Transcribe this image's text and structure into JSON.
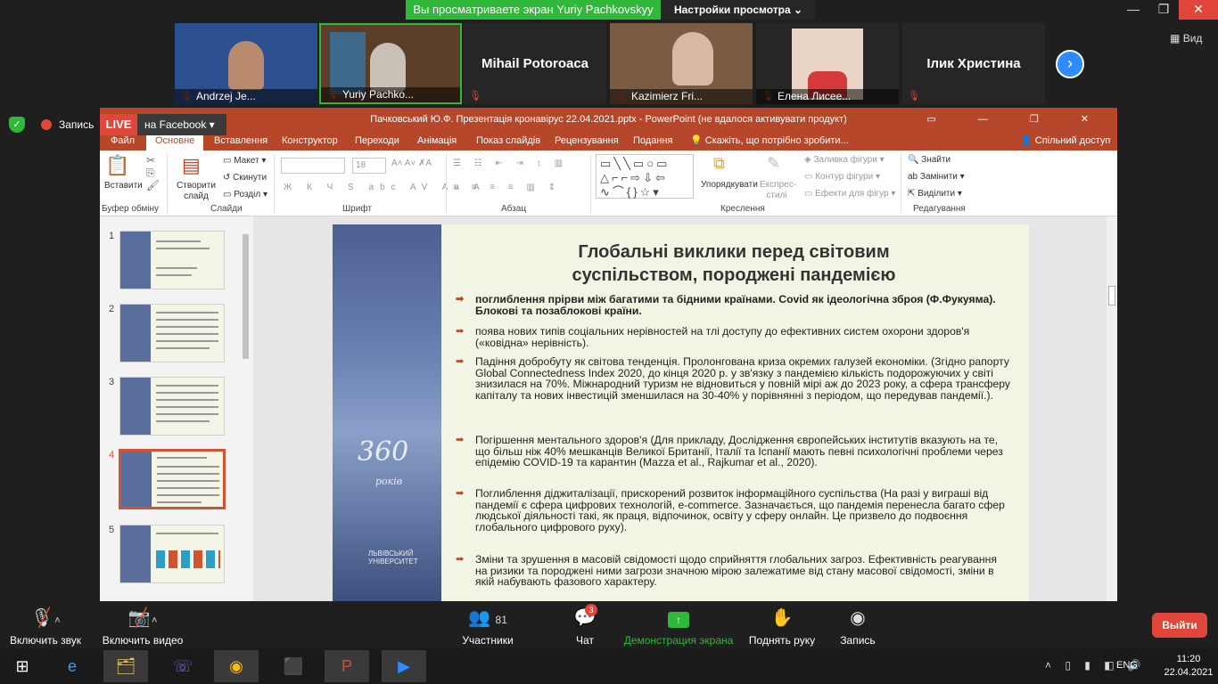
{
  "zoom_top": {
    "share_banner": "Вы просматриваете экран Yuriy Pachkovskyy",
    "view_settings": "Настройки просмотра",
    "view_label": "Вид",
    "win_min": "▭",
    "win_restore": "❐",
    "win_close": "✕"
  },
  "participants": [
    {
      "name": "Andrzej Je...",
      "type": "video"
    },
    {
      "name": "Yuriy Pachko...",
      "type": "video"
    },
    {
      "name": "Mihail Potoroaca",
      "type": "name"
    },
    {
      "name": "Kazimierz Fri...",
      "type": "video"
    },
    {
      "name": "Елена Лисее...",
      "type": "video"
    },
    {
      "name": "Ілик Христина",
      "type": "name"
    }
  ],
  "recording": {
    "label": "Запись",
    "live": "LIVE",
    "live_target": "на Facebook"
  },
  "ppt": {
    "title": "Пачковський Ю.Ф. Презентація кронавірус  22.04.2021.pptx  -  PowerPoint (не вдалося активувати продукт)",
    "tabs": [
      "Файл",
      "Основне",
      "Вставлення",
      "Конструктор",
      "Переходи",
      "Анімація",
      "Показ слайдів",
      "Рецензування",
      "Подання"
    ],
    "search": "Скажіть, що потрібно зробити...",
    "share": "Спільний доступ",
    "ribbon": {
      "paste": "Вставити",
      "new_slide": "Створити слайд",
      "layout": "Макет",
      "reset": "Скинути",
      "section": "Розділ",
      "font_size": "18",
      "arrange": "Упорядкувати",
      "quick_styles": "Експрес-стилі",
      "fill": "Заливка фігури",
      "outline": "Контур фігури",
      "effects": "Ефекти для фігур",
      "find": "Знайти",
      "replace": "Замінити",
      "select": "Виділити",
      "groups": [
        "Буфер обміну",
        "Слайди",
        "Шрифт",
        "Абзац",
        "Креслення",
        "Редагування"
      ]
    },
    "thumbs": [
      "1",
      "2",
      "3",
      "4",
      "5"
    ],
    "slide": {
      "title_line1": "Глобальні виклики перед світовим",
      "title_line2": "суспільством, породжені пандемією",
      "brand_number": "360",
      "brand_word": "років",
      "brand_uni": "ЛЬВІВСЬКИЙ УНІВЕРСИТЕТ",
      "bullets": [
        "поглиблення прірви між багатими та бідними країнами. Covid як ідеологічна зброя  (Ф.Фукуяма). Блокові та позаблокові країни.",
        "поява нових типів соціальних нерівностей на тлі доступу до ефективних систем охорони здоров'я («ковідна» нерівність).",
        "Падіння добробуту як світова тенденція. Пролонгована криза окремих галузей економіки. (Згідно рапорту Global Connectedness Index 2020, до кінця 2020 р. у зв'язку з пандемією кількість подорожуючих у світі знизилася на 70%. Міжнародний туризм не відновиться у повній мірі аж до 2023 року, а сфера трансферу капіталу та нових інвестицій зменшилася на 30-40% у порівнянні з періодом, що передував пандемії.).",
        "Погіршення ментального здоров'я (Для  прикладу, Дослідження європейських інститутів вказують на те, що більш ніж 40% мешканців Великої Британії, Італії та Іспанії мають певні психологічні проблеми через епідемію COVID-19 та карантин (Mazza et al., Rajkumar et al., 2020).",
        "Поглиблення діджиталізації, прискорений розвиток інформаційного суспільства (На разі у виграші від пандемії є сфера цифрових технологій, e-commerce. Зазначається, що пандемія перенесла багато сфер людської діяльності такі, як праця, відпочинок, освіту у сферу онлайн. Це призвело до подвоєння глобального цифрового руху).",
        "Зміни та зрушення в масовій свідомості щодо сприйняття глобальних загроз. Ефективність реагування на ризики та породжені ними загрози значною мірою залежатиме від стану масової свідомості, зміни в якій набувають фазового характеру."
      ]
    }
  },
  "bottom": {
    "mic": "Включить звук",
    "video": "Включить видео",
    "participants": "Участники",
    "participants_count": "81",
    "chat": "Чат",
    "chat_badge": "3",
    "share": "Демонстрация экрана",
    "raise": "Поднять руку",
    "record": "Запись",
    "leave": "Выйти"
  },
  "tray": {
    "lang": "ENG",
    "time": "11:20",
    "date": "22.04.2021"
  }
}
